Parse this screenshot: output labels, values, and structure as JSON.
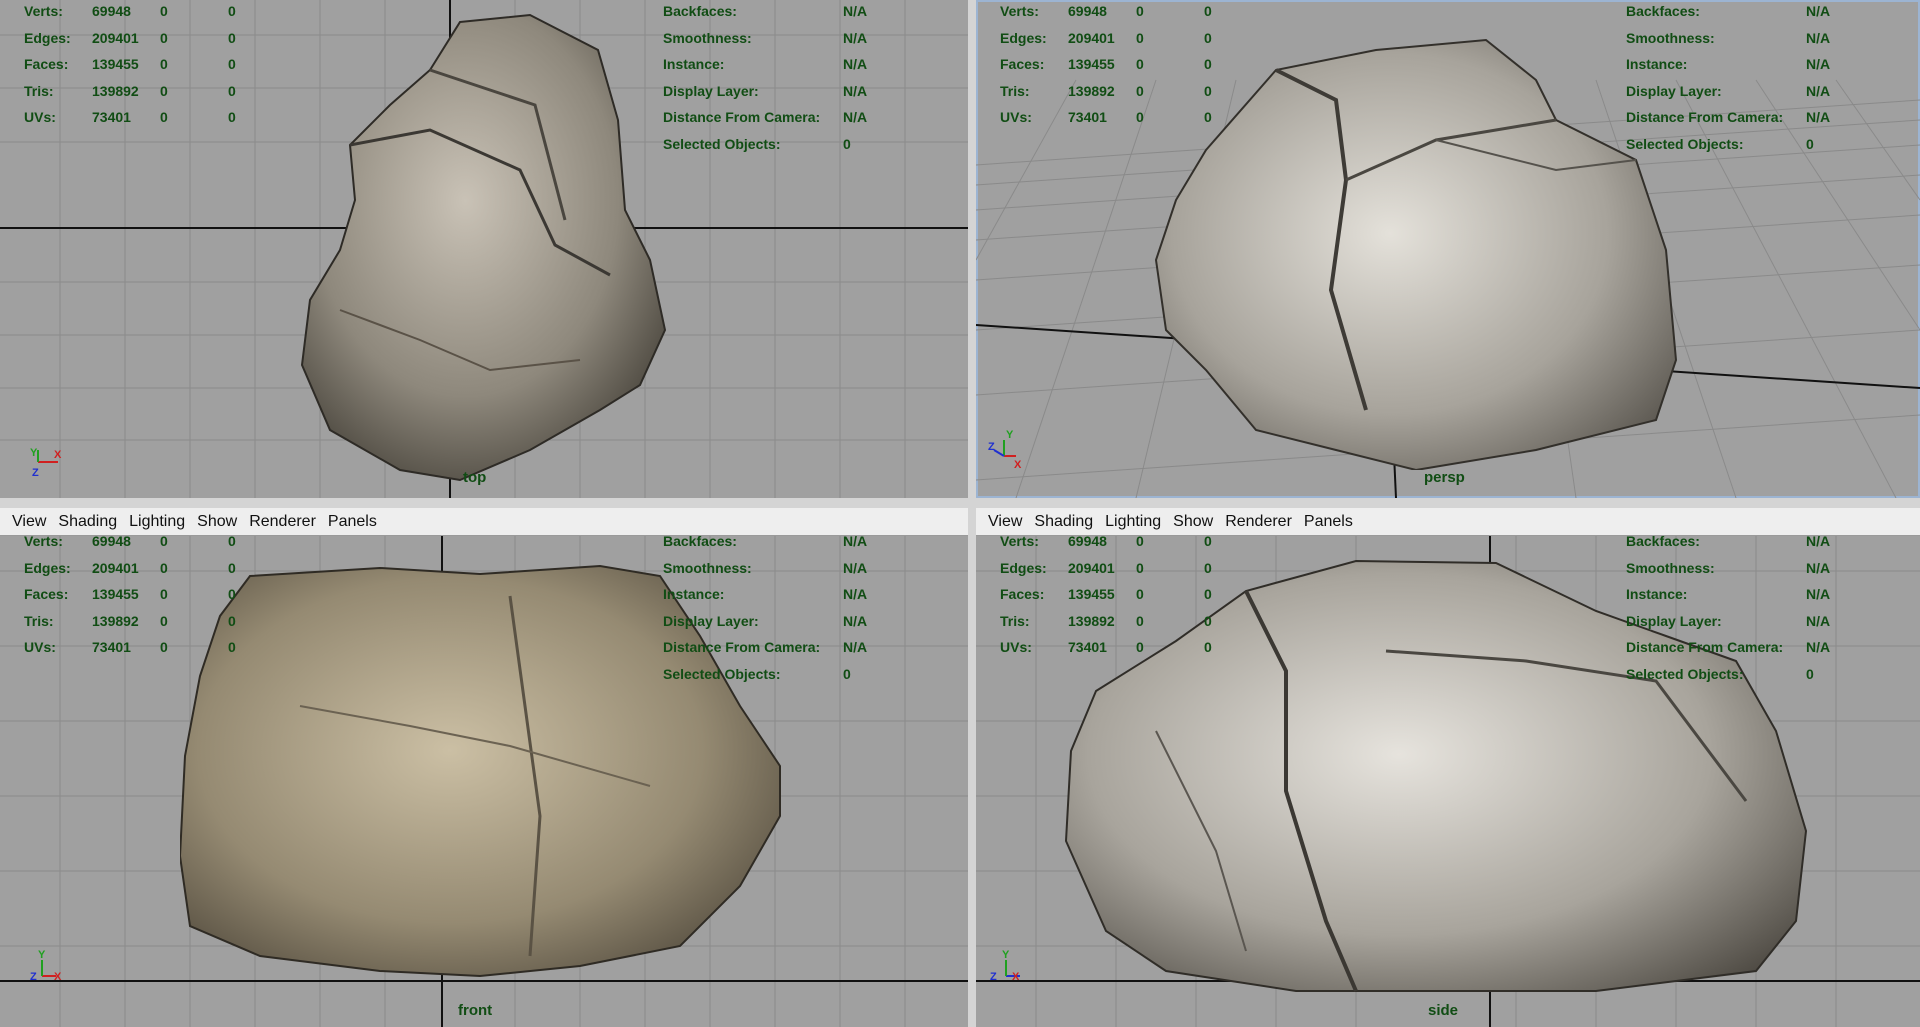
{
  "menu": [
    "View",
    "Shading",
    "Lighting",
    "Show",
    "Renderer",
    "Panels"
  ],
  "hud": {
    "left": [
      {
        "label": "Verts:",
        "value": "69948",
        "sel": "0",
        "comp": "0"
      },
      {
        "label": "Edges:",
        "value": "209401",
        "sel": "0",
        "comp": "0"
      },
      {
        "label": "Faces:",
        "value": "139455",
        "sel": "0",
        "comp": "0"
      },
      {
        "label": "Tris:",
        "value": "139892",
        "sel": "0",
        "comp": "0"
      },
      {
        "label": "UVs:",
        "value": "73401",
        "sel": "0",
        "comp": "0"
      }
    ],
    "right": [
      {
        "label": "Backfaces:",
        "value": "N/A"
      },
      {
        "label": "Smoothness:",
        "value": "N/A"
      },
      {
        "label": "Instance:",
        "value": "N/A"
      },
      {
        "label": "Display Layer:",
        "value": "N/A"
      },
      {
        "label": "Distance From Camera:",
        "value": "N/A"
      },
      {
        "label": "Selected Objects:",
        "value": "0"
      }
    ]
  },
  "viewports": {
    "top": {
      "camera": "top",
      "axis_h": "X",
      "axis_v": "Y",
      "axis_depth": "Z"
    },
    "persp": {
      "camera": "persp",
      "axis_h": "X",
      "axis_v": "Y",
      "axis_depth": "Z"
    },
    "front": {
      "camera": "front",
      "axis_h": "X",
      "axis_v": "Y",
      "axis_depth": "Z"
    },
    "side": {
      "camera": "side",
      "axis_h": "Z",
      "axis_v": "Y",
      "axis_depth": "X"
    }
  },
  "colors": {
    "viewport_bg": "#a0a0a0",
    "hud_text": "#114d14",
    "grid_line": "#8a8a8a",
    "grid_axis": "#111111",
    "active_border": "#9cb4d2"
  }
}
